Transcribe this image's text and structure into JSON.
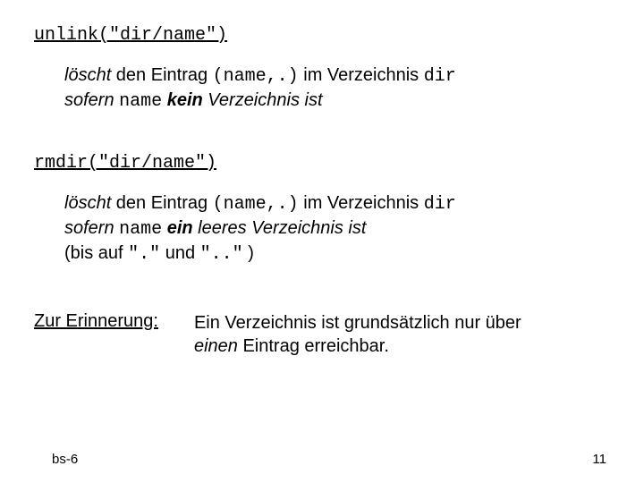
{
  "block1": {
    "heading": "unlink(\"dir/name\")",
    "l1_pre": "löscht",
    "l1_mid1": " den Eintrag ",
    "l1_code1": "(name,.)",
    "l1_mid2": " im Verzeichnis ",
    "l1_code2": "dir",
    "l2_pre": "sofern ",
    "l2_code": "name",
    "l2_bold": " kein",
    "l2_tail": " Verzeichnis ist"
  },
  "block2": {
    "heading": "rmdir(\"dir/name\")",
    "l1_pre": "löscht",
    "l1_mid1": " den Eintrag ",
    "l1_code1": "(name,.)",
    "l1_mid2": " im Verzeichnis ",
    "l1_code2": "dir",
    "l2_pre": "sofern ",
    "l2_code": "name",
    "l2_bold": " ein",
    "l2_ital": " leeres ",
    "l2_tail": "Verzeichnis ist",
    "l3_pre": "(bis auf ",
    "l3_code1": "\".\"",
    "l3_mid": " und ",
    "l3_code2": "\"..\"",
    "l3_tail": " )"
  },
  "reminder": {
    "label": "Zur Erinnerung:",
    "text1": "Ein Verzeichnis ist grundsätzlich nur über",
    "text2_ital": "einen",
    "text2_tail": " Eintrag erreichbar."
  },
  "footer": {
    "left": "bs-6",
    "right": "11"
  }
}
